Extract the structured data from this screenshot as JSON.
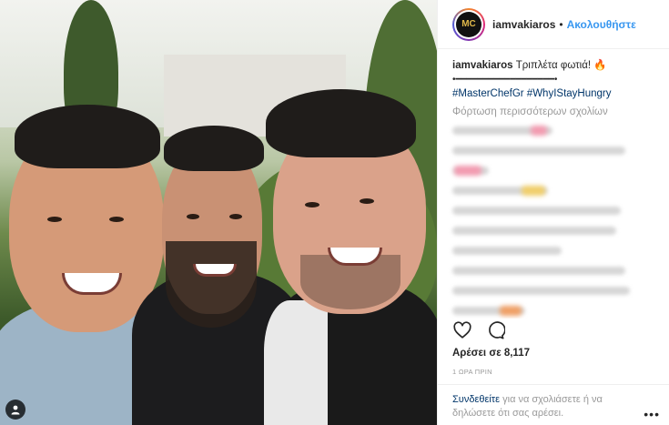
{
  "post": {
    "username": "iamvakiaros",
    "follow_label": "Ακολουθήστε",
    "separator": "•",
    "caption_text": "Τριπλέτα φωτιά! 🔥",
    "caption_divider": "•━━━━━━━━━━━━━━━━━━•",
    "hashtags": "#MasterChefGr #WhyIStayHungry",
    "load_more": "Φόρτωση περισσότερων σχολίων",
    "likes": "Αρέσει σε 8,117",
    "time": "1 ΩΡΑ ΠΡΙΝ",
    "login_link": "Συνδεθείτε",
    "login_text": " για να σχολιάσετε ή να δηλώσετε ότι σας αρέσει.",
    "more_options": "•••"
  },
  "icons": {
    "heart": "heart-icon",
    "comment": "comment-icon",
    "user_tag": "user-tag-icon",
    "avatar_logo": "MC"
  },
  "colors": {
    "link_blue": "#3897f0",
    "hashtag_blue": "#003569",
    "muted": "#999999"
  }
}
